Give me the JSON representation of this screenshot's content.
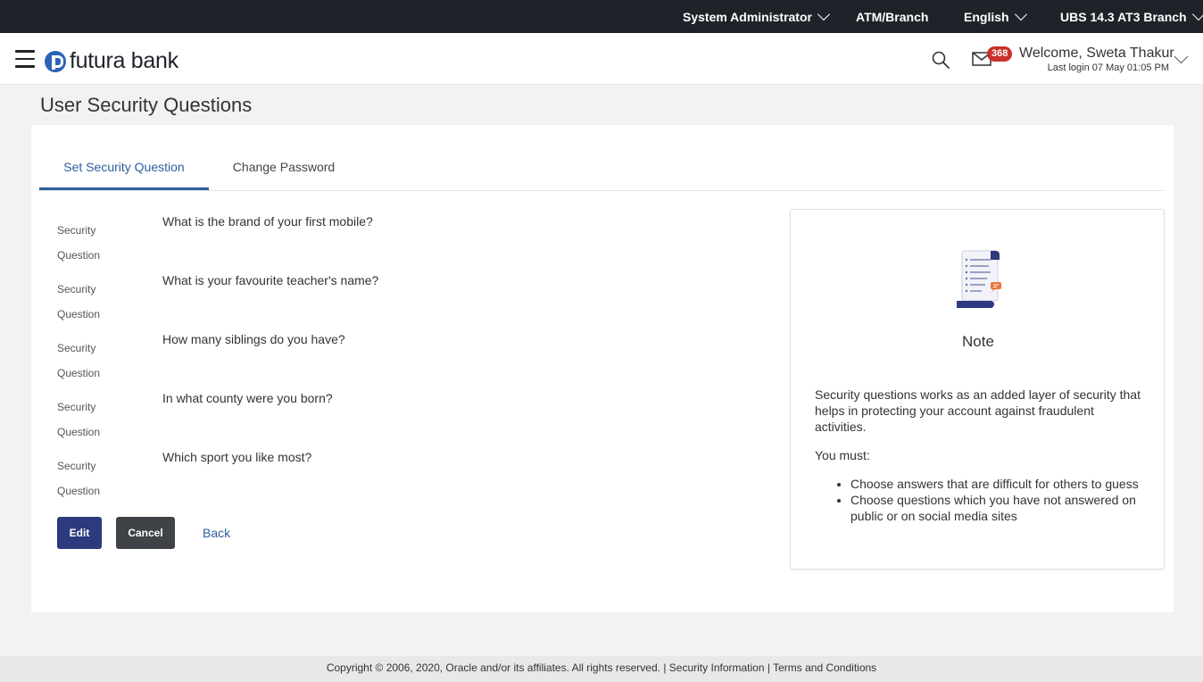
{
  "topbar": {
    "role": "System Administrator",
    "branch": "ATM/Branch",
    "language": "English",
    "entity": "UBS 14.3 AT3 Branch"
  },
  "header": {
    "logo_text": "futura bank",
    "mail_count": "368",
    "welcome": "Welcome, Sweta Thakur",
    "last_login": "Last login 07 May 01:05 PM"
  },
  "page": {
    "title": "User Security Questions"
  },
  "tabs": [
    {
      "label": "Set Security Question",
      "active": true
    },
    {
      "label": "Change Password",
      "active": false
    }
  ],
  "questions": [
    {
      "label_1": "Security",
      "label_2": "Question",
      "text": "What is the brand of your first mobile?"
    },
    {
      "label_1": "Security",
      "label_2": "Question",
      "text": "What is your favourite teacher's name?"
    },
    {
      "label_1": "Security",
      "label_2": "Question",
      "text": "How many siblings do you have?"
    },
    {
      "label_1": "Security",
      "label_2": "Question",
      "text": "In what county were you born?"
    },
    {
      "label_1": "Security",
      "label_2": "Question",
      "text": "Which sport you like most?"
    }
  ],
  "actions": {
    "edit": "Edit",
    "cancel": "Cancel",
    "back": "Back"
  },
  "note": {
    "title": "Note",
    "description": "Security questions works as an added layer of security that helps in protecting your account against fraudulent activities.",
    "must": "You must:",
    "items": [
      "Choose answers that are difficult for others to guess",
      "Choose questions which you have not answered on public or on social media sites"
    ]
  },
  "footer": {
    "copyright": "Copyright © 2006, 2020, Oracle and/or its affiliates. All rights reserved.",
    "separator": "|",
    "security_info": "Security Information",
    "terms": "Terms and Conditions"
  },
  "colors": {
    "topbar_bg": "#1f2329",
    "primary": "#2d3a7d",
    "link": "#2e5d9f",
    "badge": "#c8312c"
  }
}
